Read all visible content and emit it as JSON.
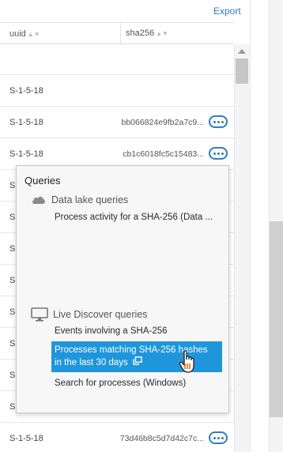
{
  "header": {
    "export_label": "Export"
  },
  "table": {
    "columns": [
      {
        "label": "uuid"
      },
      {
        "label": "sha256"
      }
    ],
    "rows": [
      {
        "uuid": "S-1-5-18",
        "sha256": ""
      },
      {
        "uuid": "S-1-5-18",
        "sha256": "bb066824e9fb2a7c9..."
      },
      {
        "uuid": "S-1-5-18",
        "sha256": "cb1c6018fc5c15483..."
      },
      {
        "uuid": "S-1-5-18",
        "sha256": "73d46b8c5d7d42c7c..."
      }
    ],
    "partial_uuid": "S"
  },
  "popover": {
    "title": "Queries",
    "data_lake": {
      "label": "Data lake queries",
      "items": [
        "Process activity for a SHA-256 (Data ..."
      ]
    },
    "live_discover": {
      "label": "Live Discover queries",
      "items": [
        "Events involving a SHA-256",
        "Processes matching SHA-256 hashes in the last 30 days",
        "Search for processes (Windows)"
      ],
      "highlight_line1": "Processes matching SHA-256 hashes",
      "highlight_line2": "in the last 30 days"
    }
  },
  "colors": {
    "accent": "#2f7dc0",
    "highlight": "#1f96dc"
  },
  "icons": {
    "cloud": "cloud-icon",
    "monitor": "monitor-icon",
    "external": "open-external-icon",
    "cursor": "hand-pointer-icon"
  }
}
